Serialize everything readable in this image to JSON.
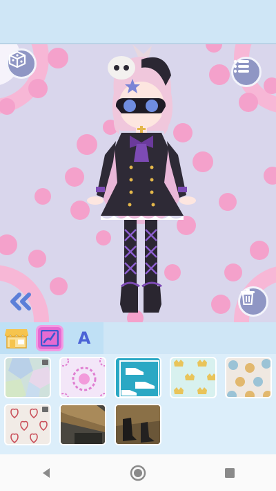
{
  "tabs": [
    {
      "id": "shop",
      "icon": "shop-icon",
      "active": false
    },
    {
      "id": "background",
      "icon": "background-brush-icon",
      "active": true
    },
    {
      "id": "text",
      "icon": "text-icon",
      "label": "A",
      "active": false
    }
  ],
  "background_tiles": [
    {
      "pattern": "pastel-hexagon-pattern",
      "locked": true
    },
    {
      "pattern": "purple-mandala-pattern",
      "locked": false
    },
    {
      "pattern": "teal-sneakers-pattern",
      "locked": false
    },
    {
      "pattern": "gold-crowns-pattern",
      "locked": false
    },
    {
      "pattern": "polka-dots-pattern",
      "locked": false
    },
    {
      "pattern": "red-hearts-pattern",
      "locked": true
    },
    {
      "pattern": "photo-wooden-floor",
      "locked": false
    },
    {
      "pattern": "photo-boots-on-floor",
      "locked": false
    }
  ],
  "colors": {
    "stage_bg": "#d9d6ec",
    "pink_dot": "#f4a1cb",
    "round_button": "#8f96c4",
    "active_tab": "#e56bd2",
    "accent_blue": "#4b63d6"
  }
}
